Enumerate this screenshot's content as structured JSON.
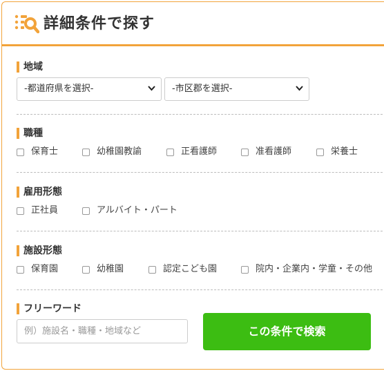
{
  "header": {
    "title": "詳細条件で探す",
    "icon": "search-list-icon",
    "accent_color": "#f2a33a"
  },
  "area": {
    "title": "地域",
    "prefecture_select": "-都道府県を選択-",
    "city_select": "-市区郡を選択-"
  },
  "job_type": {
    "title": "職種",
    "options": [
      "保育士",
      "幼稚園教諭",
      "正看護師",
      "准看護師",
      "栄養士"
    ]
  },
  "employment": {
    "title": "雇用形態",
    "options": [
      "正社員",
      "アルバイト・パート"
    ]
  },
  "facility": {
    "title": "施設形態",
    "options": [
      "保育園",
      "幼稚園",
      "認定こども園",
      "院内・企業内・学童・その他"
    ]
  },
  "freeword": {
    "title": "フリーワード",
    "placeholder": "例）施設名・職種・地域など",
    "submit_label": "この条件で検索",
    "submit_color": "#3cbd12"
  }
}
